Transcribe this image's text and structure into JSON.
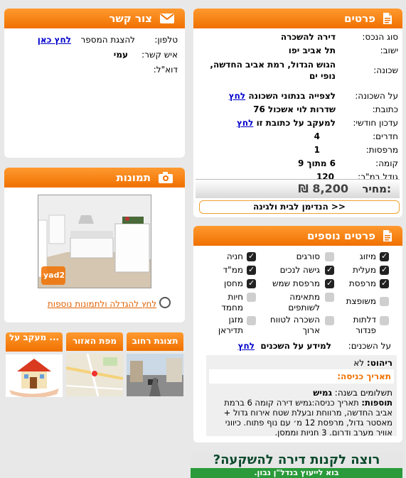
{
  "details": {
    "title": "פרטים",
    "rows": [
      {
        "key": "סוג הנכס:",
        "value": "דירה להשכרה"
      },
      {
        "key": "ישוב:",
        "value": "תל אביב יפו"
      },
      {
        "key": "שכונה:",
        "value": "הגוש הגדול, רמת אביב החדשה, נופי ים"
      },
      {
        "key": "על השכונה:",
        "value": "לצפייה בנתוני השכונה",
        "link": "לחץ"
      },
      {
        "key": "כתובת:",
        "value": "שדרות לוי אשכול 76"
      },
      {
        "key": "עדכון חודשי:",
        "value": "למעקב על כתובת זו",
        "link": "לחץ"
      },
      {
        "key": "חדרים:",
        "value": "4"
      },
      {
        "key": "מרפסות:",
        "value": "1"
      },
      {
        "key": "קומה:",
        "value": "6 מתוך 9"
      },
      {
        "key": "גודל במ\"ר:",
        "value": "120"
      }
    ],
    "price_label": "מחיר:",
    "price_value": "8,200 ₪",
    "promo_button": "הנדימן לבית ולגינה >>"
  },
  "contact": {
    "title": "צור קשר",
    "phone_label": "טלפון:",
    "phone_text": "להצגת המספר",
    "phone_link": "לחץ כאן",
    "person_label": "איש קשר:",
    "person_value": "עמי",
    "email_label": "דוא\"ל:"
  },
  "photos": {
    "title": "תמונות",
    "watermark": "yad2",
    "enlarge_link": "לחץ להגדלה ולתמונות נוספות"
  },
  "tiles": [
    {
      "label": "תצוגת רחוב"
    },
    {
      "label": "מפת האזור"
    },
    {
      "label": "מעקב על ..."
    }
  ],
  "extra": {
    "title": "פרטים נוספים",
    "features": [
      {
        "label": "מיזוג",
        "on": true
      },
      {
        "label": "סורגים",
        "on": false
      },
      {
        "label": "חניה",
        "on": true
      },
      {
        "label": "מעלית",
        "on": true
      },
      {
        "label": "גישה לנכים",
        "on": true
      },
      {
        "label": "ממ\"ד",
        "on": true
      },
      {
        "label": "מרפסת",
        "on": true
      },
      {
        "label": "מרפסת שמש",
        "on": true
      },
      {
        "label": "מחסן",
        "on": true
      },
      {
        "label": "משופצת",
        "on": false
      },
      {
        "label": "מתאימה לשותפים",
        "on": false
      },
      {
        "label": "חיות מחמד",
        "on": false
      },
      {
        "label": "דלתות פנדור",
        "on": false
      },
      {
        "label": "השכרה לטווח ארוך",
        "on": false
      },
      {
        "label": "מזגן תדיראן",
        "on": false
      }
    ],
    "neighbors_label": "על השכנים:",
    "neighbors_text": "למידע על השכנים",
    "neighbors_link": "לחץ",
    "furniture_label": "ריהוט:",
    "furniture_value": "לא",
    "entry_label": "תאריך כניסה:",
    "payments_label": "תשלומים בשנה:",
    "payments_value": "גמיש",
    "additions_label": "תוספות:",
    "additions_text": "תאריך כניסה:גמיש דירה קומה 6 ברמת אביב החדשה, מרווחת ובעלת שטח אירוח גדול + מאסטר גדול, מרפסת 12 מ׳ עם נוף פתוח. כיווני אוויר מערב ודרום. 3 חניות וממסן."
  },
  "banner": {
    "headline": "רוצה לקנות דירה להשקעה?",
    "subline": "בוא לייעוץ בנדל\"ן נבון."
  }
}
